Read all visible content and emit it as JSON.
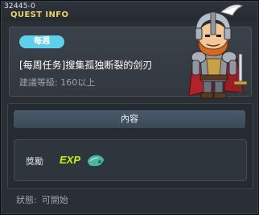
{
  "window": {
    "quest_id": "32445-0",
    "title": "QUEST INFO"
  },
  "quest": {
    "badge": "每週",
    "name": "[每周任务]搜集孤独断裂的剑刃",
    "level_requirement": "建議等級: 160以上"
  },
  "content": {
    "header": "內容",
    "reward_label": "獎勵",
    "reward_icons": [
      "exp-icon",
      "item-icon"
    ]
  },
  "status": {
    "label": "狀態:",
    "value": "可開始"
  },
  "colors": {
    "title": "#e9d36a",
    "badge": "#5fd0eb",
    "exp": "#c8e635"
  }
}
